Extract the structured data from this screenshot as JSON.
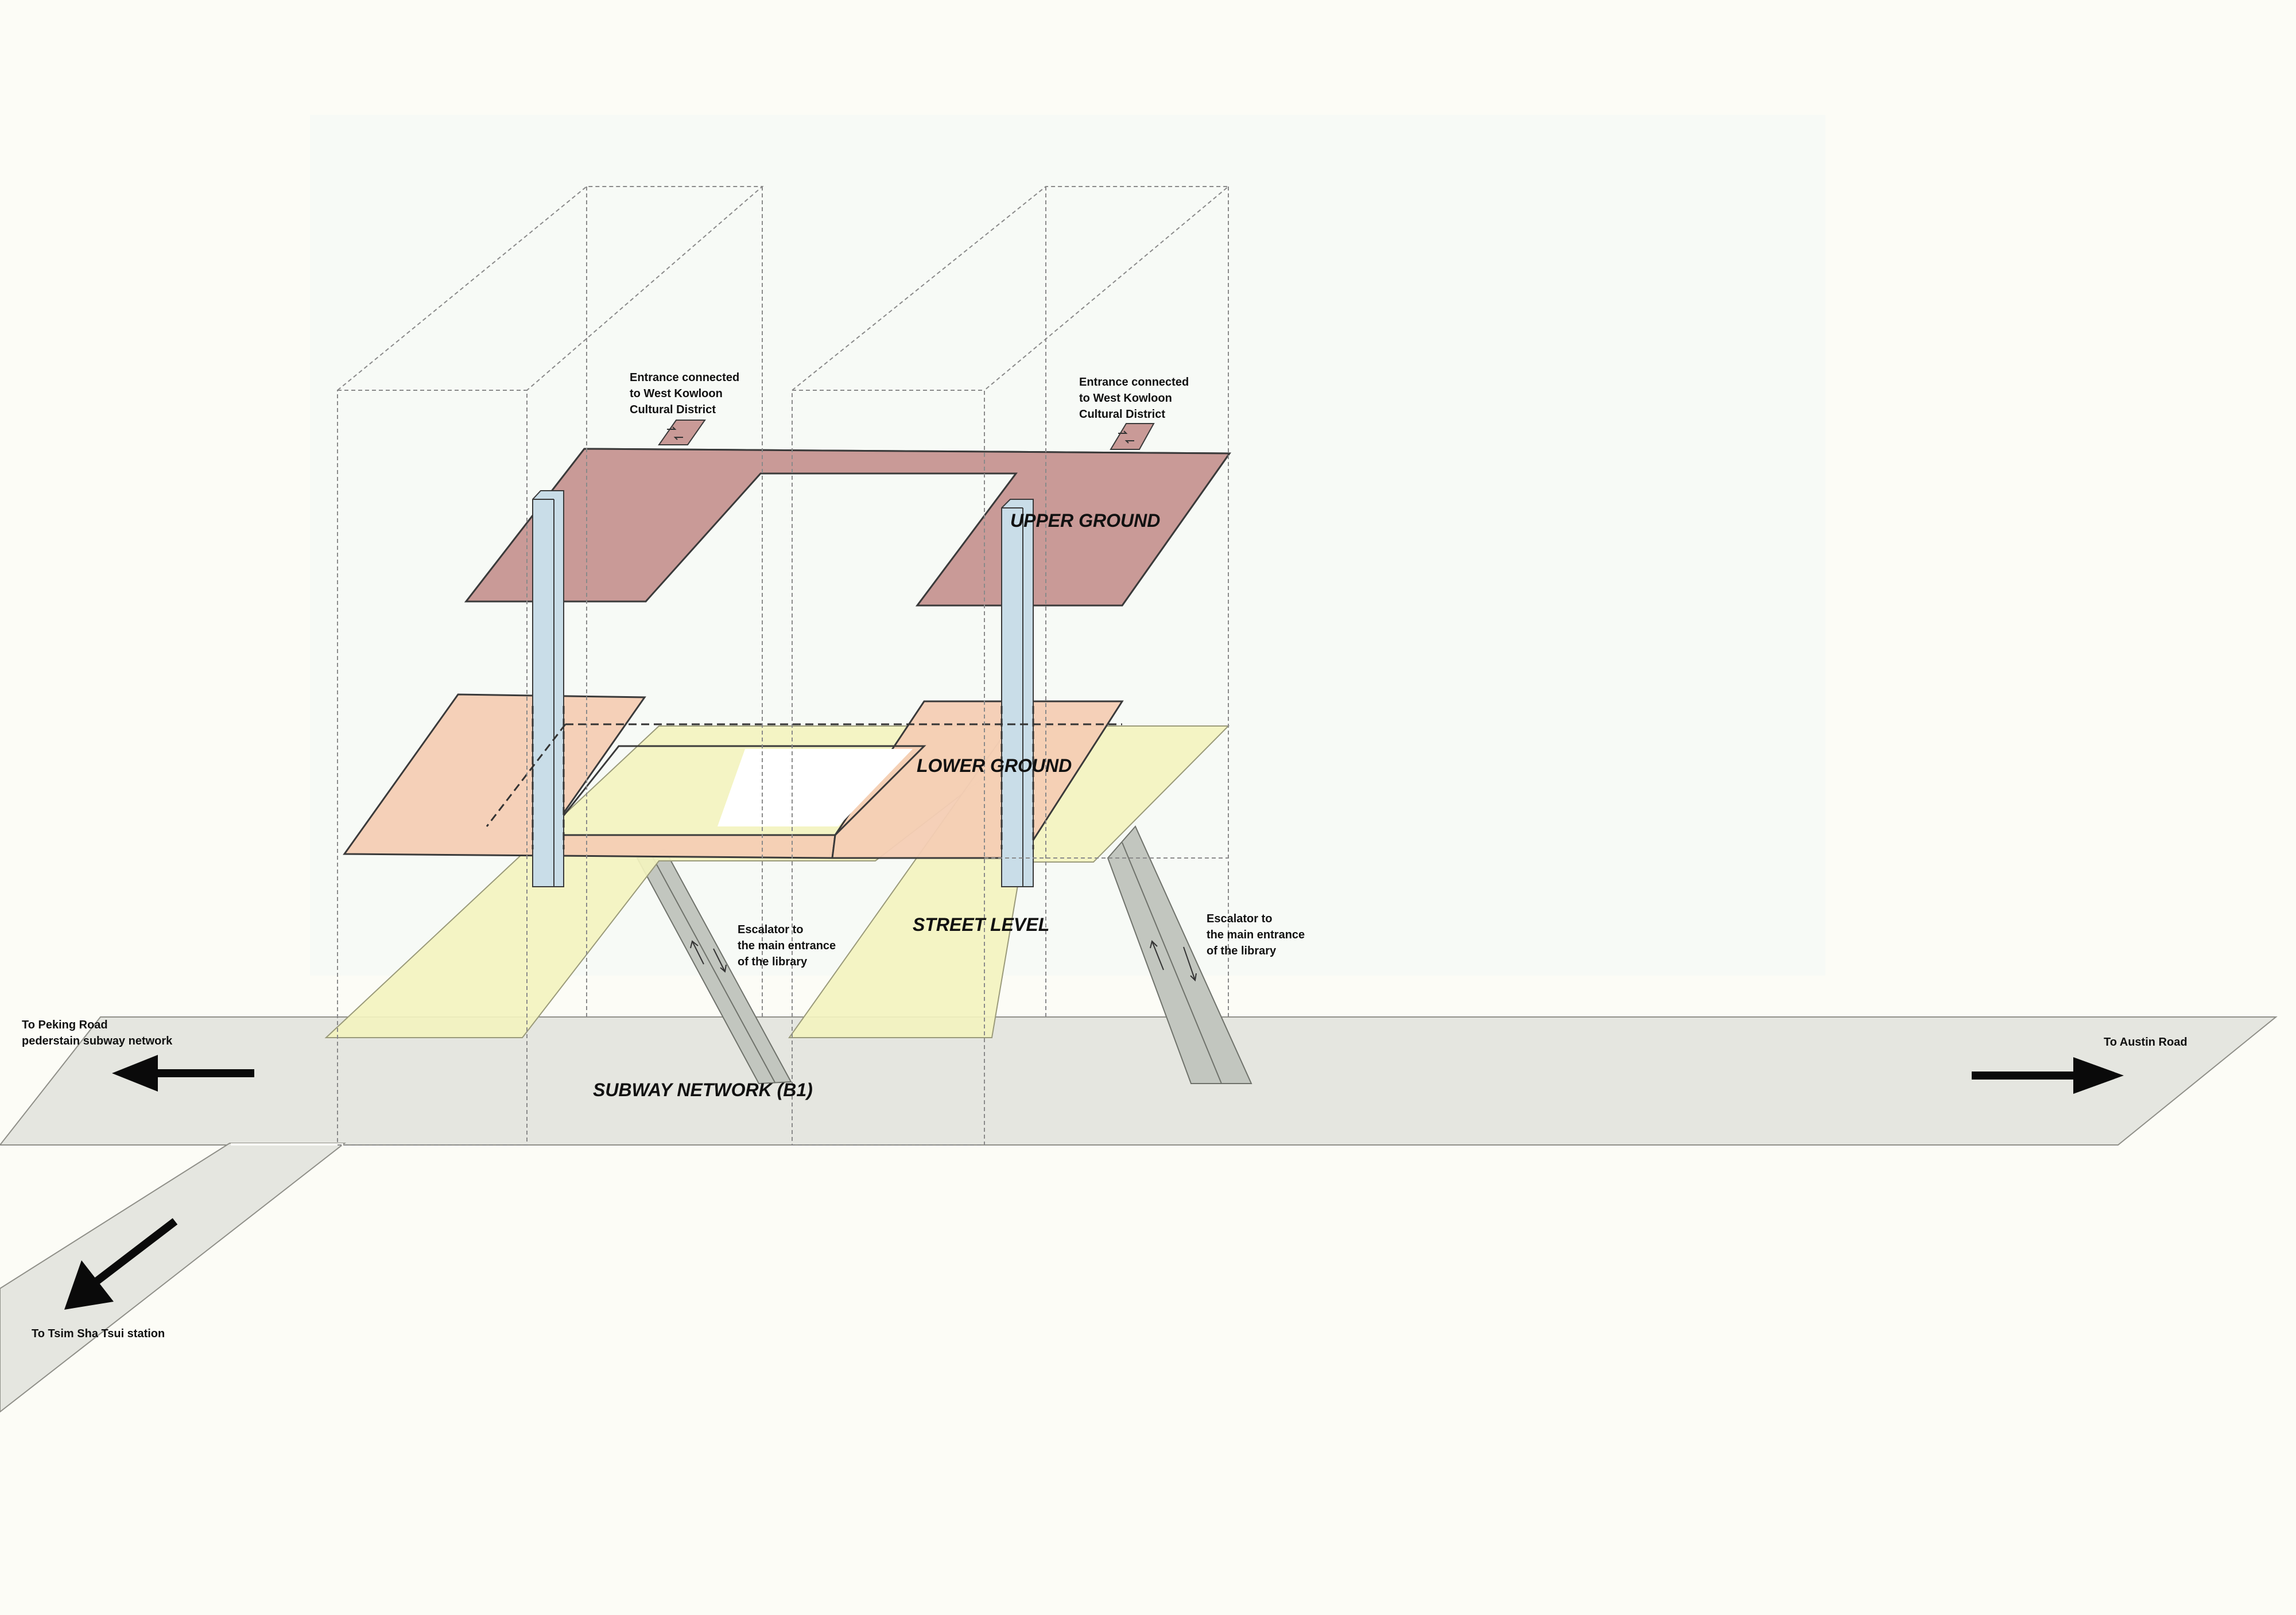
{
  "colors": {
    "background": "#fcfcf6",
    "subway": "#e5e6e0",
    "street_level": "#f3f3bf",
    "lower_ground": "#f4cdb4",
    "upper_ground": "#c99a97",
    "core": "#c9dde8",
    "escalator": "#c2c6bf",
    "arrow": "#0a0a0a"
  },
  "levels": {
    "upper_ground": "UPPER GROUND",
    "lower_ground": "LOWER GROUND",
    "street_level": "STREET LEVEL",
    "subway_network": "SUBWAY NETWORK (B1)"
  },
  "entrances": [
    {
      "line1": "Entrance connected",
      "line2": "to West Kowloon",
      "line3": "Cultural District"
    },
    {
      "line1": "Entrance connected",
      "line2": "to West Kowloon",
      "line3": "Cultural District"
    }
  ],
  "escalators": [
    {
      "line1": "Escalator to",
      "line2": "the main entrance",
      "line3": "of the library"
    },
    {
      "line1": "Escalator to",
      "line2": "the main entrance",
      "line3": "of the library"
    }
  ],
  "directions": {
    "peking_line1": "To Peking Road",
    "peking_line2": "pederstain subway network",
    "austin": "To Austin Road",
    "tsim_sha_tsui": "To Tsim Sha Tsui station"
  },
  "icons": {
    "direction_arrow": "arrow-icon",
    "escalator_direction": "up-down-arrows-icon"
  }
}
